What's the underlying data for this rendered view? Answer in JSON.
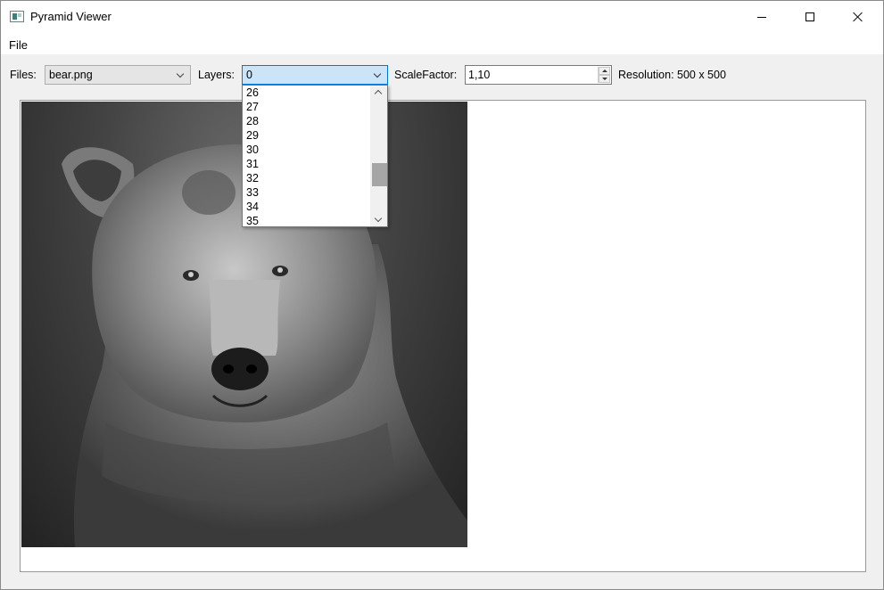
{
  "window": {
    "title": "Pyramid Viewer"
  },
  "menu": {
    "file": "File"
  },
  "toolbar": {
    "files_label": "Files:",
    "files_value": "bear.png",
    "layers_label": "Layers:",
    "layers_value": "0",
    "scale_label": "ScaleFactor:",
    "scale_value": "1,10",
    "resolution_label": "Resolution: 500 x 500"
  },
  "layers_dropdown": {
    "items": [
      "26",
      "27",
      "28",
      "29",
      "30",
      "31",
      "32",
      "33",
      "34",
      "35"
    ]
  },
  "colors": {
    "active_combo_bg": "#cce4f7",
    "active_combo_border": "#0078d7",
    "window_bg": "#f0f0f0"
  }
}
